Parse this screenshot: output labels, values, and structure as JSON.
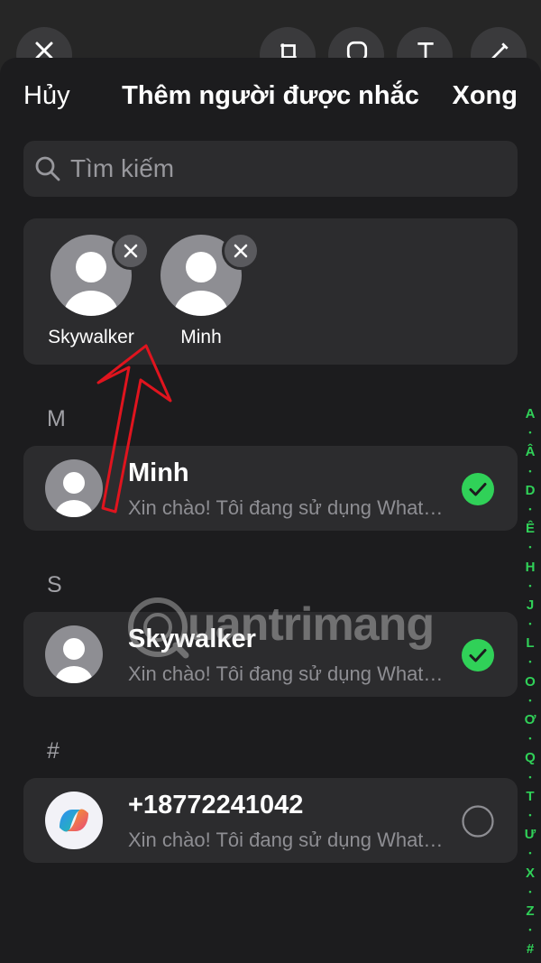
{
  "header": {
    "cancel_label": "Hủy",
    "title": "Thêm người được nhắc",
    "done_label": "Xong"
  },
  "search": {
    "placeholder": "Tìm kiếm"
  },
  "selected": [
    {
      "name": "Skywalker"
    },
    {
      "name": "Minh"
    }
  ],
  "sections": [
    {
      "letter": "M",
      "contacts": [
        {
          "name": "Minh",
          "status": "Xin chào! Tôi đang sử dụng WhatsApp.",
          "selected": true,
          "avatar": "person-icon"
        }
      ]
    },
    {
      "letter": "S",
      "contacts": [
        {
          "name": "Skywalker",
          "status": "Xin chào! Tôi đang sử dụng WhatsApp.",
          "selected": true,
          "avatar": "person-icon"
        }
      ]
    },
    {
      "letter": "#",
      "contacts": [
        {
          "name": "+18772241042",
          "status": "Xin chào! Tôi đang sử dụng WhatsApp.",
          "selected": false,
          "avatar": "copilot-logo-icon"
        }
      ]
    }
  ],
  "index": [
    "A",
    "•",
    "Â",
    "•",
    "D",
    "•",
    "Ê",
    "•",
    "H",
    "•",
    "J",
    "•",
    "L",
    "•",
    "O",
    "•",
    "Ơ",
    "•",
    "Q",
    "•",
    "T",
    "•",
    "Ư",
    "•",
    "X",
    "•",
    "Z",
    "•",
    "#"
  ],
  "watermark": {
    "text": "uantrimang"
  },
  "colors": {
    "background": "#1c1c1e",
    "card": "#2c2c2e",
    "accent_green": "#30d158",
    "annotation_red": "#e0141e"
  }
}
